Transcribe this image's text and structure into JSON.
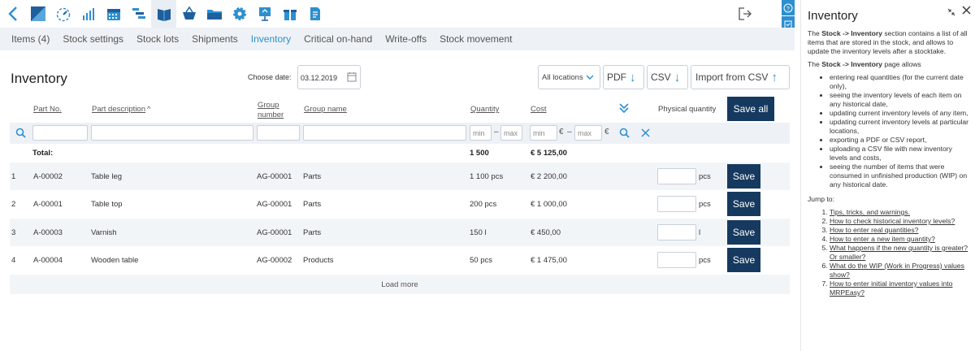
{
  "toolbar": {
    "icons": [
      "back-icon",
      "dashboard-icon",
      "gauge-icon",
      "stats-icon",
      "calendar-icon",
      "gantt-icon",
      "stock-book-icon",
      "basket-icon",
      "folder-icon",
      "gear-icon",
      "presentation-icon",
      "gift-icon",
      "document-icon"
    ],
    "active_index": 6
  },
  "subnav": {
    "tabs": [
      "Items (4)",
      "Stock settings",
      "Stock lots",
      "Shipments",
      "Inventory",
      "Critical on-hand",
      "Write-offs",
      "Stock movement"
    ],
    "active_index": 4
  },
  "page": {
    "title": "Inventory",
    "choose_date_label": "Choose date:",
    "date_value": "03.12.2019",
    "locations_label": "All locations",
    "pdf_label": "PDF",
    "csv_label": "CSV",
    "import_label": "Import from CSV",
    "save_all_label": "Save all"
  },
  "columns": {
    "part_no": "Part No.",
    "part_desc": "Part description",
    "group_number_1": "Group",
    "group_number_2": "number",
    "group_name": "Group name",
    "quantity": "Quantity",
    "cost": "Cost",
    "physical_quantity": "Physical quantity"
  },
  "filters": {
    "min": "min",
    "max": "max",
    "dash": "–",
    "currency": "€"
  },
  "totals": {
    "label": "Total:",
    "quantity": "1 500",
    "cost": "€ 5 125,00"
  },
  "rows": [
    {
      "num": "1",
      "part_no": "A-00002",
      "desc": "Table leg",
      "group_no": "AG-00001",
      "group_name": "Parts",
      "qty": "1 100 pcs",
      "cost": "€ 2 200,00",
      "unit": "pcs",
      "save": "Save"
    },
    {
      "num": "2",
      "part_no": "A-00001",
      "desc": "Table top",
      "group_no": "AG-00001",
      "group_name": "Parts",
      "qty": "200 pcs",
      "cost": "€ 1 000,00",
      "unit": "pcs",
      "save": "Save"
    },
    {
      "num": "3",
      "part_no": "A-00003",
      "desc": "Varnish",
      "group_no": "AG-00001",
      "group_name": "Parts",
      "qty": "150 l",
      "cost": "€ 450,00",
      "unit": "l",
      "save": "Save"
    },
    {
      "num": "4",
      "part_no": "A-00004",
      "desc": "Wooden table",
      "group_no": "AG-00002",
      "group_name": "Products",
      "qty": "50 pcs",
      "cost": "€ 1 475,00",
      "unit": "pcs",
      "save": "Save"
    }
  ],
  "load_more": "Load more",
  "help": {
    "title": "Inventory",
    "intro_parts": [
      "The ",
      "Stock -> Inventory",
      " section contains a list of all items that are stored in the stock, and allows to update the inventory levels after a stocktake."
    ],
    "allows_parts": [
      "The ",
      "Stock -> Inventory",
      " page allows"
    ],
    "bullets": [
      "entering real quantities (for the current date only),",
      "seeing the inventory levels of each item on any historical date,",
      "updating current inventory levels of any item,",
      "updating current inventory levels at particular locations,",
      "exporting a PDF or CSV report,",
      "uploading a CSV file with new inventory levels and costs,",
      "seeing the number of items that were consumed in unfinished production (WIP) on any historical date."
    ],
    "jump_to": "Jump to:",
    "links": [
      "Tips, tricks, and warnings.",
      "How to check historical inventory levels?",
      "How to enter real quantities?",
      "How to enter a new item quantity?",
      "What happens if the new quantity is greater? Or smaller?",
      "What do the WIP (Work in Progress) values show?",
      "How to enter initial inventory values into MRPEasy?"
    ]
  },
  "colors": {
    "accent": "#2d8fd0",
    "dark_button": "#163a5f",
    "stripe": "#f2f5f8"
  }
}
